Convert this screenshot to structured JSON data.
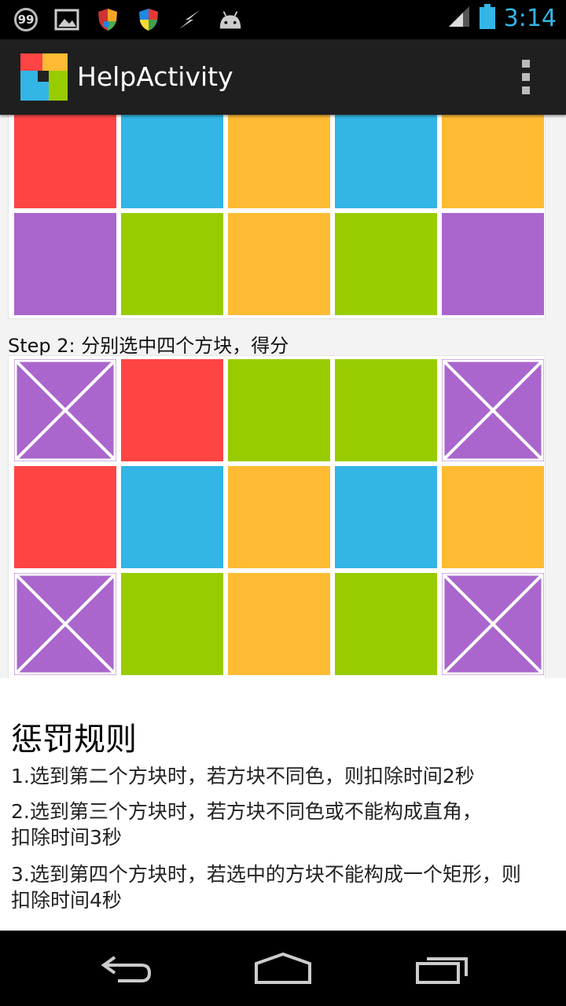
{
  "status_bar": {
    "notification_count": "99",
    "time": "3:14",
    "icons": [
      "notification-99-icon",
      "image-icon",
      "shield-icon",
      "shield-icon",
      "lightning-icon",
      "android-icon",
      "signal-icon",
      "battery-icon"
    ]
  },
  "action_bar": {
    "title": "HelpActivity",
    "overflow_icon": "more-vert-icon"
  },
  "colors": {
    "red": "#ff4444",
    "blue": "#33b5e5",
    "orange": "#ffbb33",
    "green": "#99cc00",
    "purple": "#aa66cc",
    "accent": "#33b5e5"
  },
  "grid1": {
    "rows": [
      [
        "red",
        "blue",
        "orange",
        "blue",
        "orange"
      ],
      [
        "purple",
        "green",
        "orange",
        "green",
        "purple"
      ]
    ]
  },
  "step2": {
    "label": "Step 2: 分别选中四个方块，得分",
    "rows": [
      [
        {
          "color": "purple",
          "selected": true
        },
        {
          "color": "red",
          "selected": false
        },
        {
          "color": "green",
          "selected": false
        },
        {
          "color": "green",
          "selected": false
        },
        {
          "color": "purple",
          "selected": true
        }
      ],
      [
        {
          "color": "red",
          "selected": false
        },
        {
          "color": "blue",
          "selected": false
        },
        {
          "color": "orange",
          "selected": false
        },
        {
          "color": "blue",
          "selected": false
        },
        {
          "color": "orange",
          "selected": false
        }
      ],
      [
        {
          "color": "purple",
          "selected": true
        },
        {
          "color": "green",
          "selected": false
        },
        {
          "color": "orange",
          "selected": false
        },
        {
          "color": "green",
          "selected": false
        },
        {
          "color": "purple",
          "selected": true
        }
      ]
    ]
  },
  "penalty": {
    "title": "惩罚规则",
    "rules": [
      "1.选到第二个方块时，若方块不同色，则扣除时间2秒",
      "2.选到第三个方块时，若方块不同色或不能构成直角，扣除时间3秒",
      "3.选到第四个方块时，若选中的方块不能构成一个矩形，则扣除时间4秒"
    ]
  },
  "nav_bar": {
    "icons": [
      "back-icon",
      "home-icon",
      "recent-apps-icon"
    ]
  }
}
